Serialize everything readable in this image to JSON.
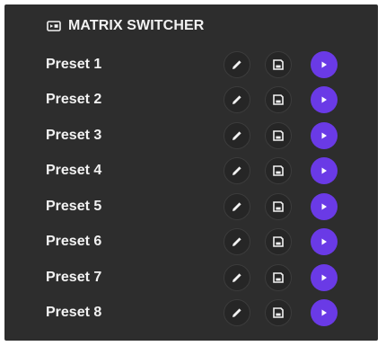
{
  "header": {
    "icon": "video-input-icon",
    "title": "MATRIX SWITCHER"
  },
  "colors": {
    "panel_bg": "#2d2d2d",
    "text": "#f2f2f2",
    "icon_button_bg": "#262626",
    "play_accent": "#6a3ae6"
  },
  "presets": [
    {
      "label": "Preset 1",
      "edit_icon": "pencil-icon",
      "save_icon": "save-icon",
      "play_icon": "play-icon"
    },
    {
      "label": "Preset 2",
      "edit_icon": "pencil-icon",
      "save_icon": "save-icon",
      "play_icon": "play-icon"
    },
    {
      "label": "Preset 3",
      "edit_icon": "pencil-icon",
      "save_icon": "save-icon",
      "play_icon": "play-icon"
    },
    {
      "label": "Preset 4",
      "edit_icon": "pencil-icon",
      "save_icon": "save-icon",
      "play_icon": "play-icon"
    },
    {
      "label": "Preset 5",
      "edit_icon": "pencil-icon",
      "save_icon": "save-icon",
      "play_icon": "play-icon"
    },
    {
      "label": "Preset 6",
      "edit_icon": "pencil-icon",
      "save_icon": "save-icon",
      "play_icon": "play-icon"
    },
    {
      "label": "Preset 7",
      "edit_icon": "pencil-icon",
      "save_icon": "save-icon",
      "play_icon": "play-icon"
    },
    {
      "label": "Preset 8",
      "edit_icon": "pencil-icon",
      "save_icon": "save-icon",
      "play_icon": "play-icon"
    }
  ]
}
